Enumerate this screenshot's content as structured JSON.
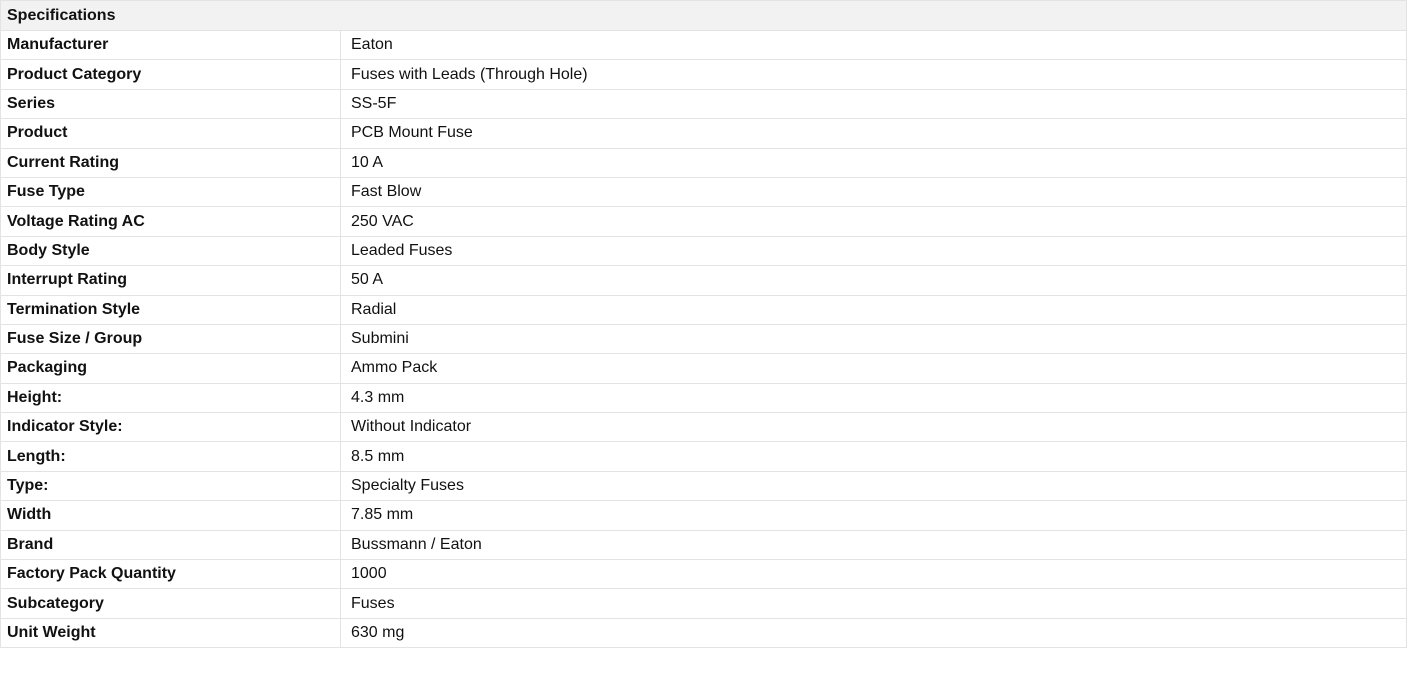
{
  "table": {
    "header": "Specifications",
    "rows": [
      {
        "label": "Manufacturer",
        "value": "Eaton"
      },
      {
        "label": "Product Category",
        "value": "Fuses with Leads (Through Hole)"
      },
      {
        "label": "Series",
        "value": "SS-5F"
      },
      {
        "label": "Product",
        "value": "PCB Mount Fuse"
      },
      {
        "label": "Current Rating",
        "value": "10 A"
      },
      {
        "label": "Fuse Type",
        "value": "Fast Blow"
      },
      {
        "label": "Voltage Rating AC",
        "value": "250 VAC"
      },
      {
        "label": "Body Style",
        "value": "Leaded Fuses"
      },
      {
        "label": "Interrupt Rating",
        "value": "50 A"
      },
      {
        "label": "Termination Style",
        "value": "Radial"
      },
      {
        "label": "Fuse Size / Group",
        "value": "Submini"
      },
      {
        "label": "Packaging",
        "value": "Ammo Pack"
      },
      {
        "label": "Height:",
        "value": "4.3 mm"
      },
      {
        "label": "Indicator Style:",
        "value": "Without Indicator"
      },
      {
        "label": "Length:",
        "value": "8.5 mm"
      },
      {
        "label": "Type:",
        "value": "Specialty Fuses"
      },
      {
        "label": "Width",
        "value": "7.85 mm"
      },
      {
        "label": "Brand",
        "value": "Bussmann / Eaton"
      },
      {
        "label": "Factory Pack Quantity",
        "value": "1000"
      },
      {
        "label": "Subcategory",
        "value": "Fuses"
      },
      {
        "label": "Unit Weight",
        "value": "630 mg"
      }
    ]
  }
}
